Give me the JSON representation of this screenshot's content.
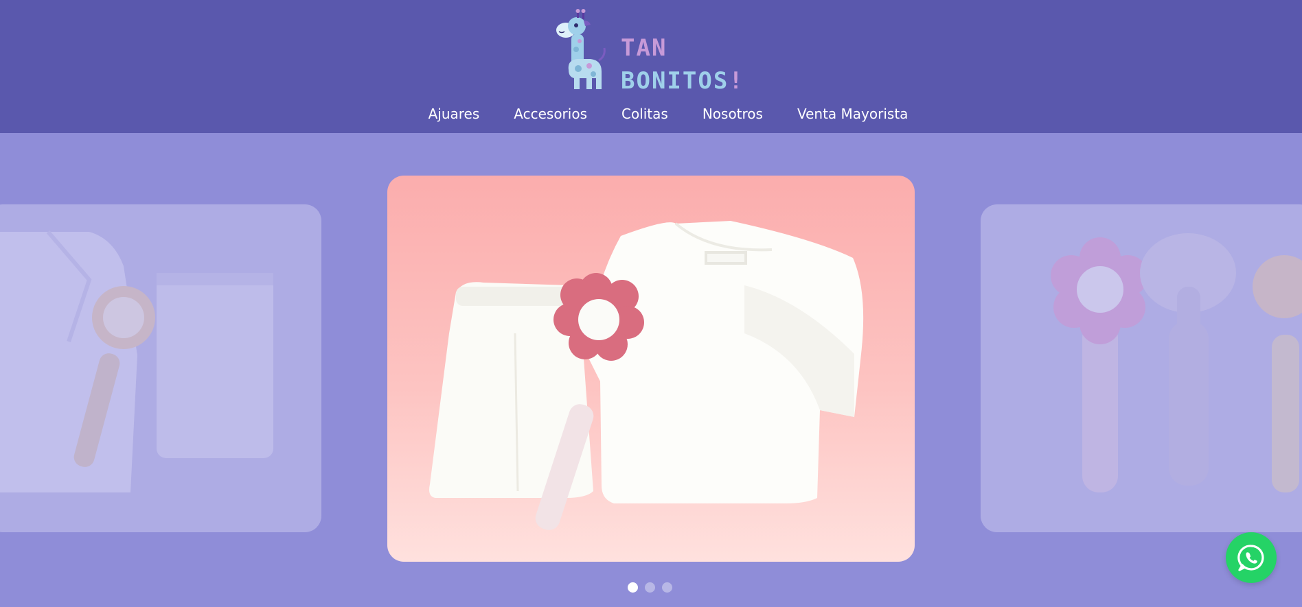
{
  "brand": {
    "line1": "TAN",
    "line2_a": "BONITOS",
    "line2_b": "!",
    "colors": {
      "pink": "#c79ad8",
      "blue": "#9fd0ea",
      "header": "#5a58ad"
    }
  },
  "nav": {
    "items": [
      {
        "label": "Ajuares"
      },
      {
        "label": "Accesorios"
      },
      {
        "label": "Colitas"
      },
      {
        "label": "Nosotros"
      },
      {
        "label": "Venta Mayorista"
      }
    ]
  },
  "carousel": {
    "slide_count": 3,
    "active_index": 0,
    "slides": [
      {
        "name": "ajuar-set-sun-rattle"
      },
      {
        "name": "ajuar-set-flower-rattle"
      },
      {
        "name": "rattles-flower-elephant-sun"
      }
    ]
  },
  "whatsapp": {
    "icon": "whatsapp-icon",
    "color": "#25d366"
  }
}
